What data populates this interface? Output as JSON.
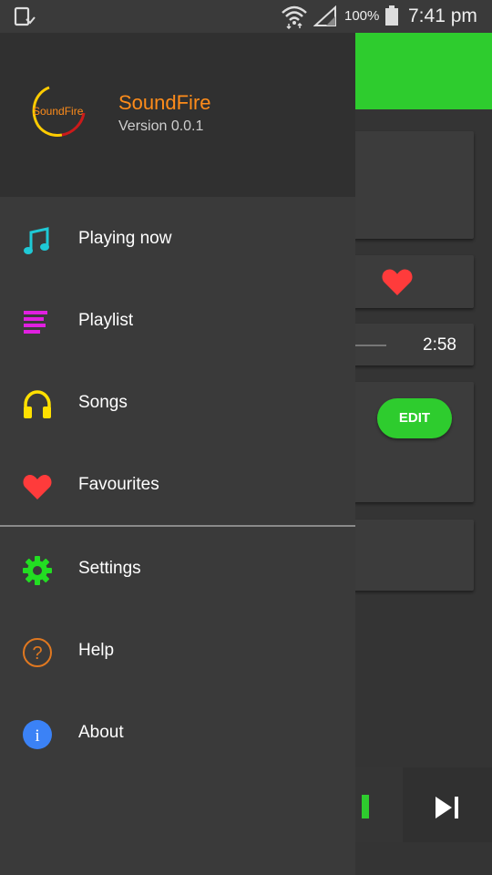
{
  "status_bar": {
    "battery": "100%",
    "time": "7:41 pm"
  },
  "header": {
    "logo_text": "SoundFire",
    "app_name": "SoundFire",
    "version": "Version 0.0.1"
  },
  "menu": {
    "items": [
      {
        "label": "Playing now",
        "icon": "music-note-icon",
        "color": "#1fc9d6"
      },
      {
        "label": "Playlist",
        "icon": "playlist-icon",
        "color": "#e020e0"
      },
      {
        "label": "Songs",
        "icon": "headphones-icon",
        "color": "#ffe000"
      },
      {
        "label": "Favourites",
        "icon": "heart-icon",
        "color": "#ff3b3b"
      }
    ],
    "secondary": [
      {
        "label": "Settings",
        "icon": "gear-icon",
        "color": "#22dd22"
      },
      {
        "label": "Help",
        "icon": "help-icon",
        "color": "#e07820"
      },
      {
        "label": "About",
        "icon": "info-icon",
        "color": "#3b82f6"
      }
    ]
  },
  "background": {
    "duration": "2:58",
    "edit_label": "EDIT"
  },
  "colors": {
    "accent_green": "#2ecc2e",
    "brand_orange": "#ff8c1a"
  }
}
